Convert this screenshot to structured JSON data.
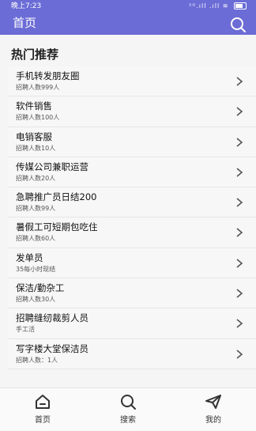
{
  "status_bar": {
    "time": "晚上7:23",
    "icons": "⁵ᴳ.ıll .ıll ≋"
  },
  "header": {
    "title": "首页",
    "search_icon": "search-icon"
  },
  "section": {
    "title": "热门推荐"
  },
  "jobs": [
    {
      "title": "手机转发朋友圈",
      "subtitle": "招聘人数999人"
    },
    {
      "title": "软件销售",
      "subtitle": "招聘人数100人"
    },
    {
      "title": "电销客服",
      "subtitle": "招聘人数10人"
    },
    {
      "title": "传媒公司兼职运营",
      "subtitle": "招聘人数20人"
    },
    {
      "title": "急聘推广员日结200",
      "subtitle": "招聘人数99人"
    },
    {
      "title": "暑假工可短期包吃住",
      "subtitle": "招聘人数60人"
    },
    {
      "title": "发单员",
      "subtitle": "35每小时现结"
    },
    {
      "title": "保洁/勤杂工",
      "subtitle": "招聘人数30人"
    },
    {
      "title": "招聘缝纫裁剪人员",
      "subtitle": "手工活"
    },
    {
      "title": "写字楼大堂保洁员",
      "subtitle": "招聘人数：1人"
    }
  ],
  "bottom_nav": {
    "home": "首页",
    "search": "搜索",
    "mine": "我的"
  },
  "colors": {
    "header_bg": "#6b6cd6"
  }
}
